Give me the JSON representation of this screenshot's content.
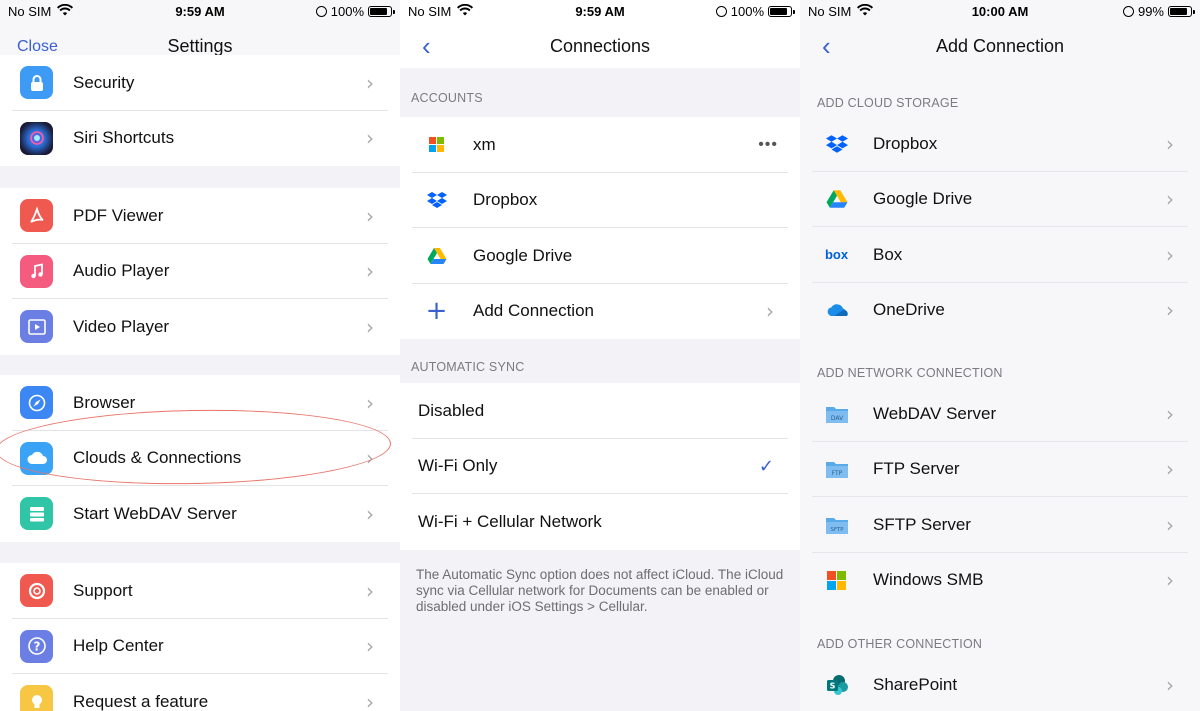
{
  "status": [
    {
      "carrier": "No SIM",
      "time": "9:59 AM",
      "battery": "100%"
    },
    {
      "carrier": "No SIM",
      "time": "9:59 AM",
      "battery": "100%"
    },
    {
      "carrier": "No SIM",
      "time": "10:00 AM",
      "battery": "99%"
    }
  ],
  "settings": {
    "title": "Settings",
    "close_label": "Close",
    "group1": [
      {
        "label": "Security",
        "icon": "lock-icon",
        "color": "#3d9bf5"
      },
      {
        "label": "Siri Shortcuts",
        "icon": "siri-icon",
        "color": "#1c1c3a"
      }
    ],
    "group2": [
      {
        "label": "PDF Viewer",
        "icon": "pdf-icon",
        "color": "#f0594f"
      },
      {
        "label": "Audio Player",
        "icon": "music-icon",
        "color": "#f45b7e"
      },
      {
        "label": "Video Player",
        "icon": "video-icon",
        "color": "#6b7ee3"
      }
    ],
    "group3": [
      {
        "label": "Browser",
        "icon": "compass-icon",
        "color": "#3d87f5"
      },
      {
        "label": "Clouds & Connections",
        "icon": "cloud-icon",
        "color": "#3ba3f5"
      },
      {
        "label": "Start WebDAV Server",
        "icon": "server-icon",
        "color": "#2fc5a6"
      }
    ],
    "group4": [
      {
        "label": "Support",
        "icon": "lifebuoy-icon",
        "color": "#f0594f"
      },
      {
        "label": "Help Center",
        "icon": "help-icon",
        "color": "#6b7ee3"
      },
      {
        "label": "Request a feature",
        "icon": "bulb-icon",
        "color": "#f7c744"
      }
    ]
  },
  "connections": {
    "title": "Connections",
    "accounts_header": "ACCOUNTS",
    "accounts": [
      {
        "label": "xm",
        "icon": "microsoft-icon"
      },
      {
        "label": "Dropbox",
        "icon": "dropbox-icon"
      },
      {
        "label": "Google Drive",
        "icon": "google-drive-icon"
      },
      {
        "label": "Add Connection",
        "icon": "plus-icon"
      }
    ],
    "sync_header": "AUTOMATIC SYNC",
    "sync_options": [
      "Disabled",
      "Wi-Fi Only",
      "Wi-Fi + Cellular Network"
    ],
    "selected_sync": "Wi-Fi Only",
    "footnote": "The Automatic Sync option does not affect iCloud. The iCloud sync via Cellular network for Documents can be enabled or disabled under iOS Settings > Cellular."
  },
  "add_connection": {
    "title": "Add Connection",
    "cloud_header": "ADD CLOUD STORAGE",
    "cloud": [
      {
        "label": "Dropbox",
        "icon": "dropbox-icon"
      },
      {
        "label": "Google Drive",
        "icon": "google-drive-icon"
      },
      {
        "label": "Box",
        "icon": "box-icon"
      },
      {
        "label": "OneDrive",
        "icon": "onedrive-icon"
      }
    ],
    "network_header": "ADD NETWORK CONNECTION",
    "network": [
      {
        "label": "WebDAV Server",
        "icon": "dav-folder-icon",
        "tag": "DAV"
      },
      {
        "label": "FTP Server",
        "icon": "ftp-folder-icon",
        "tag": "FTP"
      },
      {
        "label": "SFTP Server",
        "icon": "sftp-folder-icon",
        "tag": "SFTP"
      },
      {
        "label": "Windows SMB",
        "icon": "windows-icon"
      }
    ],
    "other_header": "ADD OTHER CONNECTION",
    "other": [
      {
        "label": "SharePoint",
        "icon": "sharepoint-icon"
      }
    ],
    "box_logo": "box"
  }
}
